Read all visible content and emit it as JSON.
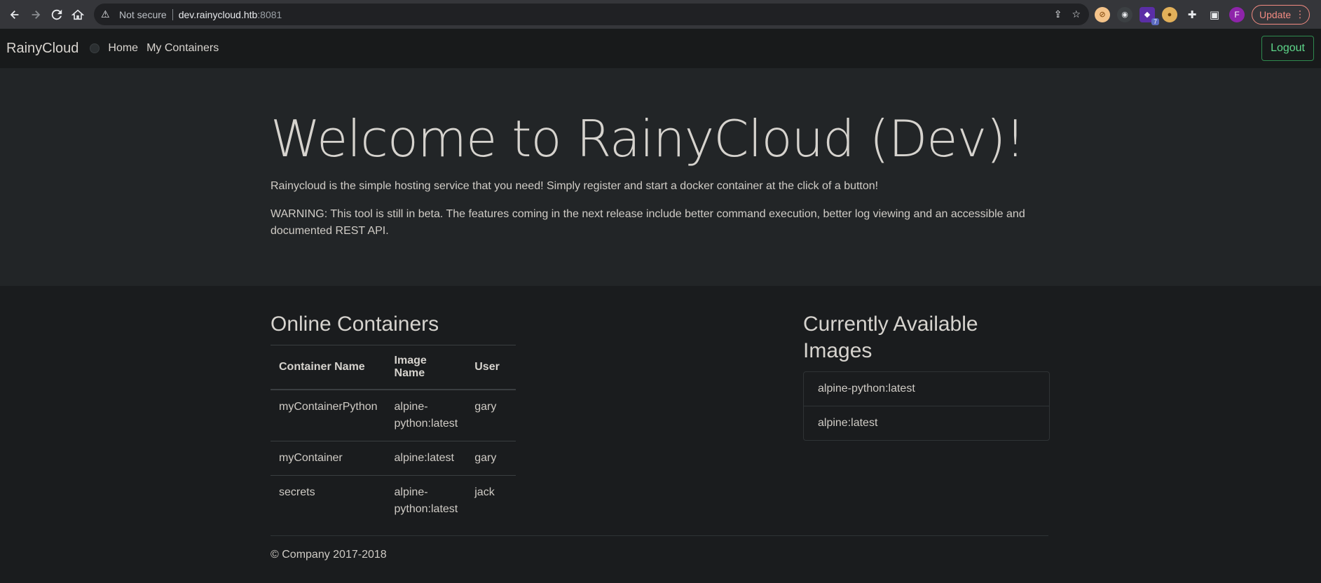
{
  "browser": {
    "security_label": "Not secure",
    "url_host": "dev.rainycloud.htb",
    "url_port": ":8081",
    "update_label": "Update",
    "profile_initial": "F",
    "extension_badge": "7"
  },
  "navbar": {
    "brand": "RainyCloud",
    "links": [
      "Home",
      "My Containers"
    ],
    "logout_label": "Logout"
  },
  "hero": {
    "title": "Welcome to RainyCloud (Dev)!",
    "lead": "Rainycloud is the simple hosting service that you need! Simply register and start a docker container at the click of a button!",
    "warning": "WARNING: This tool is still in beta. The features coming in the next release include better command execution, better log viewing and an accessible and documented REST API."
  },
  "containers": {
    "heading": "Online Containers",
    "columns": [
      "Container Name",
      "Image Name",
      "User"
    ],
    "rows": [
      [
        "myContainerPython",
        "alpine-python:latest",
        "gary"
      ],
      [
        "myContainer",
        "alpine:latest",
        "gary"
      ],
      [
        "secrets",
        "alpine-python:latest",
        "jack"
      ]
    ]
  },
  "images": {
    "heading": "Currently Available Images",
    "items": [
      "alpine-python:latest",
      "alpine:latest"
    ]
  },
  "footer": {
    "copyright": "© Company 2017-2018"
  }
}
